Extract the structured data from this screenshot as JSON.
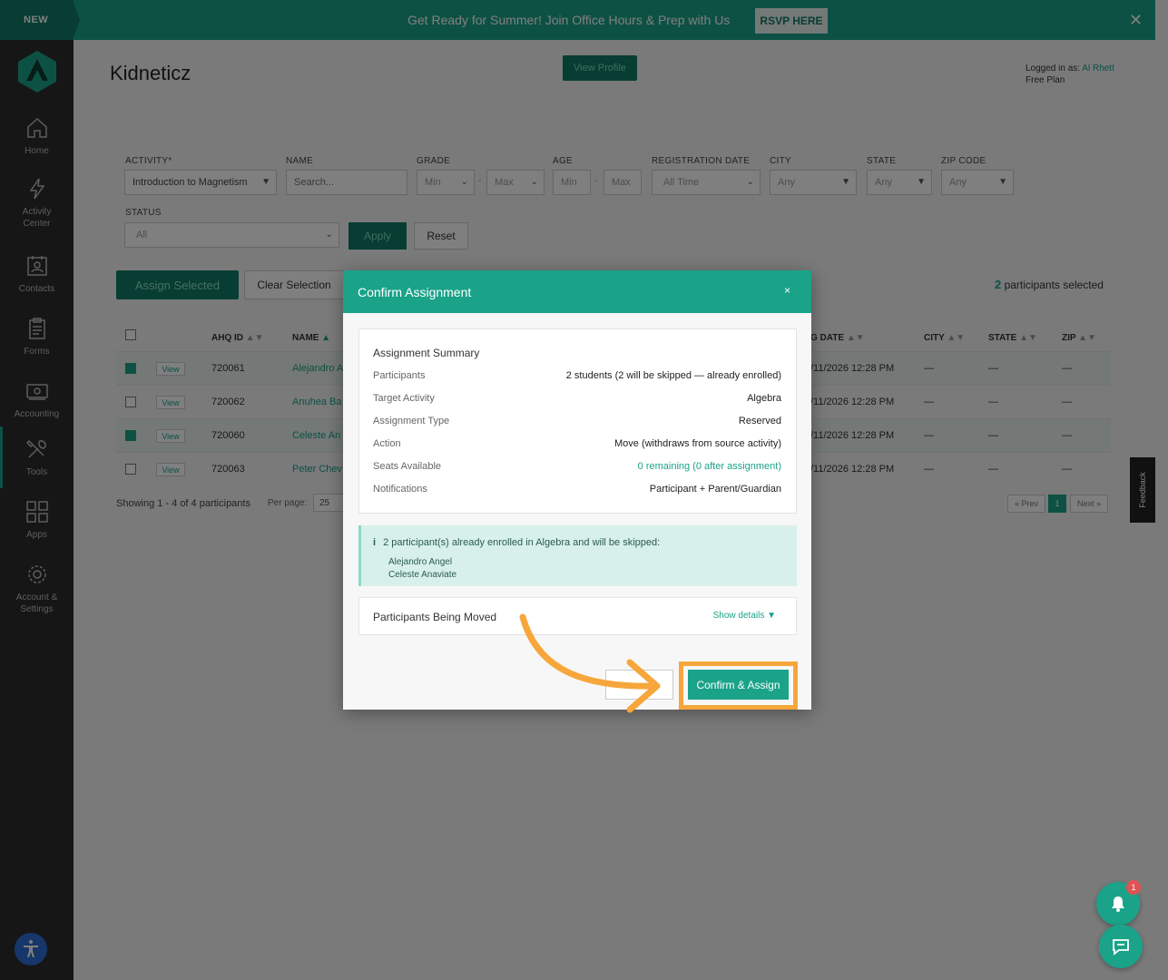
{
  "banner": {
    "badge": "NEW",
    "text": "Get Ready for Summer! Join Office Hours & Prep with Us",
    "button": "RSVP HERE",
    "close": "✕"
  },
  "sidebar": {
    "items": [
      {
        "label": "Home",
        "icon": "home-icon"
      },
      {
        "label": "Activity Center",
        "icon": "lightning-icon"
      },
      {
        "label": "Contacts",
        "icon": "contacts-icon"
      },
      {
        "label": "Forms",
        "icon": "forms-icon"
      },
      {
        "label": "Accounting",
        "icon": "accounting-icon"
      },
      {
        "label": "Tools",
        "icon": "tools-icon"
      },
      {
        "label": "Apps",
        "icon": "apps-icon"
      },
      {
        "label": "Account & Settings",
        "icon": "gear-icon"
      }
    ]
  },
  "header": {
    "title": "Kidneticz",
    "view_profile": "View Profile",
    "logged_in_prefix": "Logged in as:",
    "user": "Al Rhett",
    "plan": "Free Plan"
  },
  "filters": {
    "activity_label": "ACTIVITY*",
    "activity_value": "Introduction to Magnetism",
    "name_label": "NAME",
    "name_placeholder": "Search...",
    "grade_label": "GRADE",
    "grade_min": "Min",
    "grade_max": "Max",
    "age_label": "AGE",
    "age_min": "Min",
    "age_max": "Max",
    "reg_label": "REGISTRATION DATE",
    "reg_value": "All Time",
    "city_label": "CITY",
    "city_value": "Any",
    "state_label": "STATE",
    "state_value": "Any",
    "zip_label": "ZIP CODE",
    "zip_value": "Any",
    "status_label": "STATUS",
    "status_value": "All",
    "apply": "Apply",
    "reset": "Reset",
    "dash": "-"
  },
  "actions": {
    "assign_selected": "Assign Selected",
    "clear_selection": "Clear Selection",
    "selected_num": "2",
    "selected_text": " participants selected"
  },
  "table": {
    "headers": {
      "id": "AHQ ID",
      "name": "NAME",
      "regdate": "G DATE",
      "city": "CITY",
      "state": "STATE",
      "zip": "ZIP"
    },
    "view_label": "View",
    "rows": [
      {
        "id": "720061",
        "name": "Alejandro A",
        "date": "/11/2026 12:28 PM",
        "city": "—",
        "state": "—",
        "zip": "—"
      },
      {
        "id": "720062",
        "name": "Anuhea Ba",
        "date": "/11/2026 12:28 PM",
        "city": "—",
        "state": "—",
        "zip": "—"
      },
      {
        "id": "720060",
        "name": "Celeste An",
        "date": "/11/2026 12:28 PM",
        "city": "—",
        "state": "—",
        "zip": "—"
      },
      {
        "id": "720063",
        "name": "Peter Chev",
        "date": "/11/2026 12:28 PM",
        "city": "—",
        "state": "—",
        "zip": "—"
      }
    ],
    "showing": "Showing 1 - 4 of 4 participants",
    "per_page_label": "Per page:",
    "per_page_value": "25",
    "prev": "« Prev",
    "page": "1",
    "next": "Next »"
  },
  "feedback": "Feedback",
  "modal": {
    "title": "Confirm Assignment",
    "close": "×",
    "summary_title": "Assignment Summary",
    "rows": [
      {
        "label": "Participants",
        "value": "2 students (2 will be skipped — already enrolled)"
      },
      {
        "label": "Target Activity",
        "value": "Algebra"
      },
      {
        "label": "Assignment Type",
        "value": "Reserved"
      },
      {
        "label": "Action",
        "value": "Move (withdraws from source activity)"
      },
      {
        "label": "Seats Available",
        "value": "0 remaining (0 after assignment)"
      },
      {
        "label": "Notifications",
        "value": "Participant + Parent/Guardian"
      }
    ],
    "notice_icon": "i",
    "notice_text": "2 participant(s) already enrolled in Algebra and will be skipped:",
    "notice_names": [
      "Alejandro Angel",
      "Celeste Anaviate"
    ],
    "moving_title": "Participants Being Moved",
    "moving_show": "Show details ▼",
    "cancel": "",
    "confirm": "Confirm & Assign"
  },
  "fab": {
    "badge": "1"
  },
  "colors": {
    "brand": "#1aa389",
    "brand_dark": "#0f7a64",
    "highlight": "#f6a63b",
    "sidebar": "#2d2d2d"
  }
}
